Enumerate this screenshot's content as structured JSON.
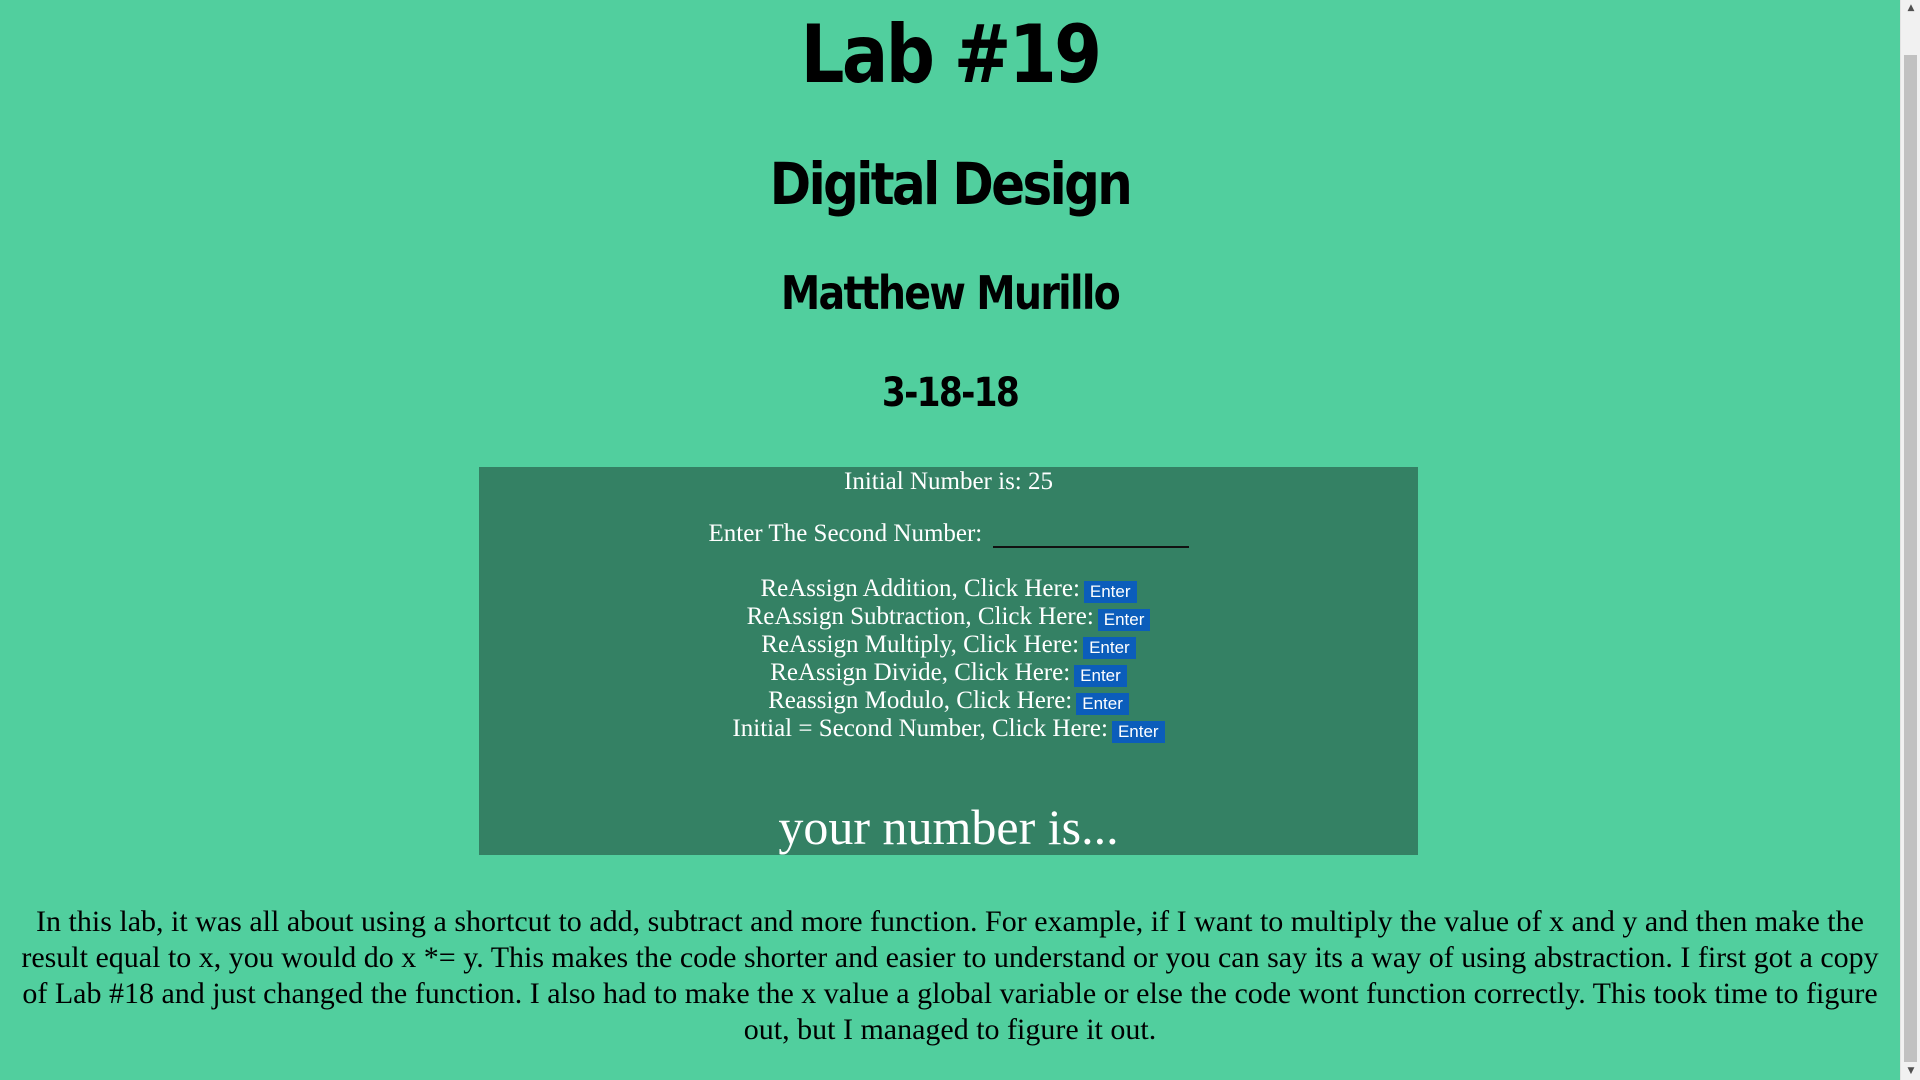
{
  "header": {
    "title": "Lab #19",
    "course": "Digital Design",
    "author": "Matthew Murillo",
    "date": "3-18-18"
  },
  "calculator": {
    "initial_label": "Initial Number is: 25",
    "second_label": "Enter The Second Number:",
    "second_value": "",
    "operations": [
      {
        "label": "ReAssign Addition, Click Here:",
        "button": "Enter"
      },
      {
        "label": "ReAssign Subtraction, Click Here:",
        "button": "Enter"
      },
      {
        "label": "ReAssign Multiply, Click Here:",
        "button": "Enter"
      },
      {
        "label": "ReAssign Divide, Click Here:",
        "button": "Enter"
      },
      {
        "label": "Reassign Modulo, Click Here:",
        "button": "Enter"
      },
      {
        "label": "Initial = Second Number, Click Here:",
        "button": "Enter"
      }
    ],
    "result": "your number is..."
  },
  "description": "In this lab, it was all about using a shortcut to add, subtract and more function. For example, if I want to multiply the value of x and y and then make the result equal to x, you would do x *= y. This makes the code shorter and easier to understand or you can say its a way of using abstraction. I first got a copy of Lab #18 and just changed the function. I also had to make the x value a global variable or else the code wont function correctly. This took time to figure out, but I managed to figure it out.",
  "scrollbar": {
    "up_icon": "scroll-up-arrow",
    "down_icon": "scroll-down-arrow"
  },
  "colors": {
    "page_background": "#51cf9e",
    "panel_background": "#348164",
    "button_background": "#0b5dbb"
  }
}
